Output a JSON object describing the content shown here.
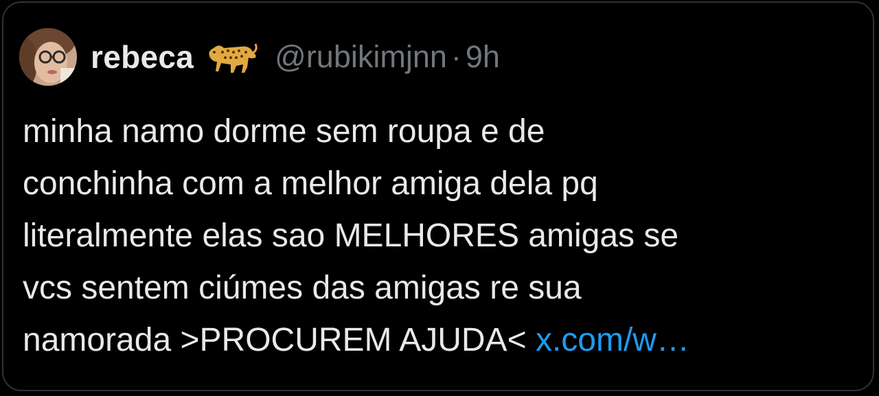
{
  "tweet": {
    "display_name": "rebeca",
    "emoji_icon": "leopard-emoji",
    "handle": "@rubikimjnn",
    "separator": "·",
    "time": "9h",
    "lines": [
      "minha namo dorme sem roupa e de",
      "conchinha com a melhor amiga dela pq",
      "literalmente elas sao MELHORES amigas se",
      "vcs sentem ciúmes das amigas re sua",
      "namorada >PROCUREM AJUDA<"
    ],
    "link_text": "x.com/w…"
  },
  "colors": {
    "background": "#000000",
    "text": "#e7e9ea",
    "secondary": "#71767b",
    "link": "#1d9bf0",
    "border": "#2f3336"
  }
}
